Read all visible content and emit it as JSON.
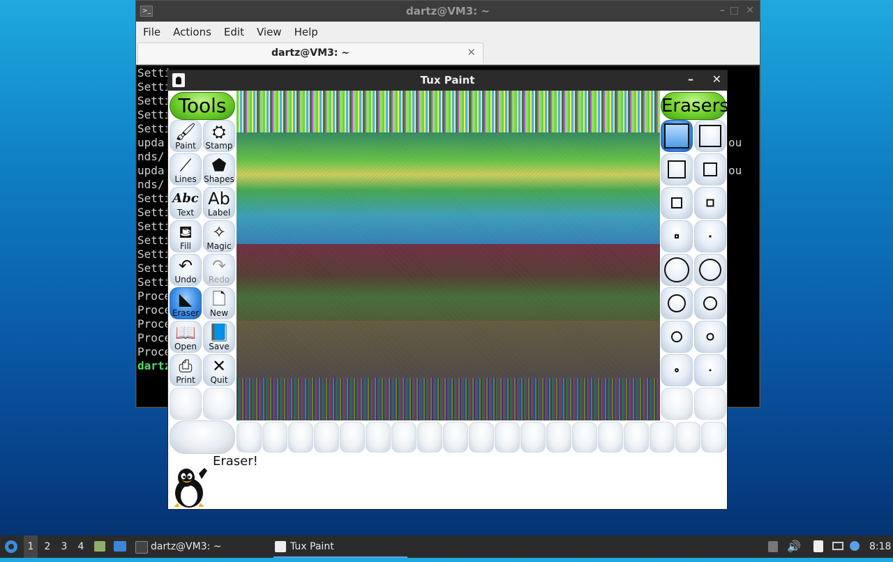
{
  "terminal": {
    "title": "dartz@VM3: ~",
    "menu": [
      "File",
      "Actions",
      "Edit",
      "View",
      "Help"
    ],
    "tab_label": "dartz@VM3: ~",
    "lines_left": [
      "Setti",
      "Setti",
      "Setti",
      "Setti",
      "Setti",
      "upda",
      "nds/",
      "upda",
      "nds/",
      "Setti",
      "Setti",
      "Setti",
      "Setti",
      "Setti",
      "Setti",
      "Setti",
      "Proce",
      "Proce",
      "Proce",
      "Proce",
      "Proce",
      "dartz"
    ],
    "lines_right": [
      "ou",
      "ou"
    ]
  },
  "tuxpaint": {
    "title": "Tux Paint",
    "tools_title": "Tools",
    "erasers_title": "Erasers",
    "tools": [
      {
        "label": "Paint",
        "icon": "paintbrush-icon",
        "glyph": "🖌",
        "state": "normal"
      },
      {
        "label": "Stamp",
        "icon": "stamp-icon",
        "glyph": "⛭",
        "state": "normal"
      },
      {
        "label": "Lines",
        "icon": "lines-icon",
        "glyph": "⟋",
        "state": "normal"
      },
      {
        "label": "Shapes",
        "icon": "pentagon-icon",
        "glyph": "⬟",
        "state": "normal"
      },
      {
        "label": "Text",
        "icon": "text-icon",
        "glyph": "Abc",
        "state": "normal"
      },
      {
        "label": "Label",
        "icon": "label-icon",
        "glyph": "Ab",
        "state": "normal"
      },
      {
        "label": "Fill",
        "icon": "fill-bucket-icon",
        "glyph": "⛾",
        "state": "normal"
      },
      {
        "label": "Magic",
        "icon": "magic-wand-icon",
        "glyph": "✧",
        "state": "normal"
      },
      {
        "label": "Undo",
        "icon": "undo-icon",
        "glyph": "↶",
        "state": "normal"
      },
      {
        "label": "Redo",
        "icon": "redo-icon",
        "glyph": "↷",
        "state": "disabled"
      },
      {
        "label": "Eraser",
        "icon": "eraser-icon",
        "glyph": "◣",
        "state": "selected"
      },
      {
        "label": "New",
        "icon": "new-document-icon",
        "glyph": "🗋",
        "state": "normal"
      },
      {
        "label": "Open",
        "icon": "open-book-icon",
        "glyph": "📖",
        "state": "normal"
      },
      {
        "label": "Save",
        "icon": "save-book-icon",
        "glyph": "📘",
        "state": "normal"
      },
      {
        "label": "Print",
        "icon": "printer-icon",
        "glyph": "⎙",
        "state": "normal"
      },
      {
        "label": "Quit",
        "icon": "quit-x-icon",
        "glyph": "✕",
        "state": "normal"
      }
    ],
    "erasers": [
      {
        "shape": "square",
        "size": 36,
        "selected": true
      },
      {
        "shape": "square",
        "size": 32,
        "selected": false
      },
      {
        "shape": "square",
        "size": 26,
        "selected": false
      },
      {
        "shape": "square",
        "size": 20,
        "selected": false
      },
      {
        "shape": "square",
        "size": 16,
        "selected": false
      },
      {
        "shape": "square",
        "size": 11,
        "selected": false
      },
      {
        "shape": "square",
        "size": 6,
        "selected": false
      },
      {
        "shape": "square",
        "size": 2,
        "selected": false
      },
      {
        "shape": "circle",
        "size": 36,
        "selected": false
      },
      {
        "shape": "circle",
        "size": 32,
        "selected": false
      },
      {
        "shape": "circle",
        "size": 26,
        "selected": false
      },
      {
        "shape": "circle",
        "size": 20,
        "selected": false
      },
      {
        "shape": "circle",
        "size": 16,
        "selected": false
      },
      {
        "shape": "circle",
        "size": 11,
        "selected": false
      },
      {
        "shape": "circle",
        "size": 6,
        "selected": false
      },
      {
        "shape": "circle",
        "size": 2,
        "selected": false
      }
    ],
    "status_message": "Eraser!"
  },
  "taskbar": {
    "workspaces": [
      "1",
      "2",
      "3",
      "4"
    ],
    "tasks": [
      {
        "label": "dartz@VM3: ~",
        "icon": "terminal-icon"
      },
      {
        "label": "Tux Paint",
        "icon": "tuxpaint-icon"
      }
    ],
    "clock": "8:18"
  }
}
